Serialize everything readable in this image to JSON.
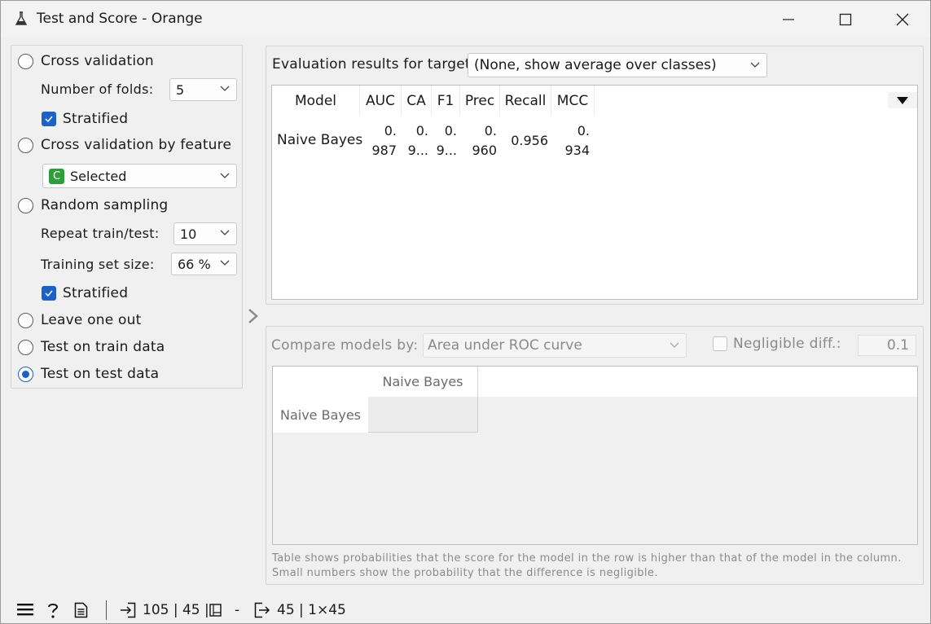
{
  "window": {
    "title": "Test and Score - Orange"
  },
  "sampling": {
    "cross_validation": "Cross validation",
    "folds_label": "Number of folds:",
    "folds_value": "5",
    "stratified_1": "Stratified",
    "cv_by_feature": "Cross validation by feature",
    "feature_badge": "C",
    "feature_value": "Selected",
    "random_sampling": "Random sampling",
    "repeat_label": "Repeat train/test:",
    "repeat_value": "10",
    "train_size_label": "Training set size:",
    "train_size_value": "66 %",
    "stratified_2": "Stratified",
    "leave_one_out": "Leave one out",
    "test_on_train": "Test on train data",
    "test_on_test": "Test on test data",
    "selected_option": "Test on test data"
  },
  "evaluation": {
    "label": "Evaluation results for target",
    "target_value": "(None, show average over classes)",
    "columns": [
      "Model",
      "AUC",
      "CA",
      "F1",
      "Prec",
      "Recall",
      "MCC"
    ],
    "row": {
      "model": "Naive Bayes",
      "auc_1": "0.",
      "auc_2": "987",
      "ca_1": "0.",
      "ca_2": "9...",
      "f1_1": "0.",
      "f1_2": "9...",
      "prec_1": "0.",
      "prec_2": "960",
      "recall": "0.956",
      "mcc_1": "0.",
      "mcc_2": "934"
    }
  },
  "compare": {
    "label": "Compare models by:",
    "metric_value": "Area under ROC curve",
    "negligible_label": "Negligible diff.:",
    "negligible_value": "0.1",
    "column_header": "Naive Bayes",
    "row_header": "Naive Bayes",
    "note_line_1": "Table shows probabilities that the score for the model in the row is higher than that of the model in the column.",
    "note_line_2": "Small numbers show the probability that the difference is negligible."
  },
  "status": {
    "input_summary": "105 | 45 |",
    "input_suffix": "-",
    "output_summary": "45 | 1×45"
  },
  "colors": {
    "accent": "#1b60c4",
    "feature_badge": "#2e9e3c"
  }
}
